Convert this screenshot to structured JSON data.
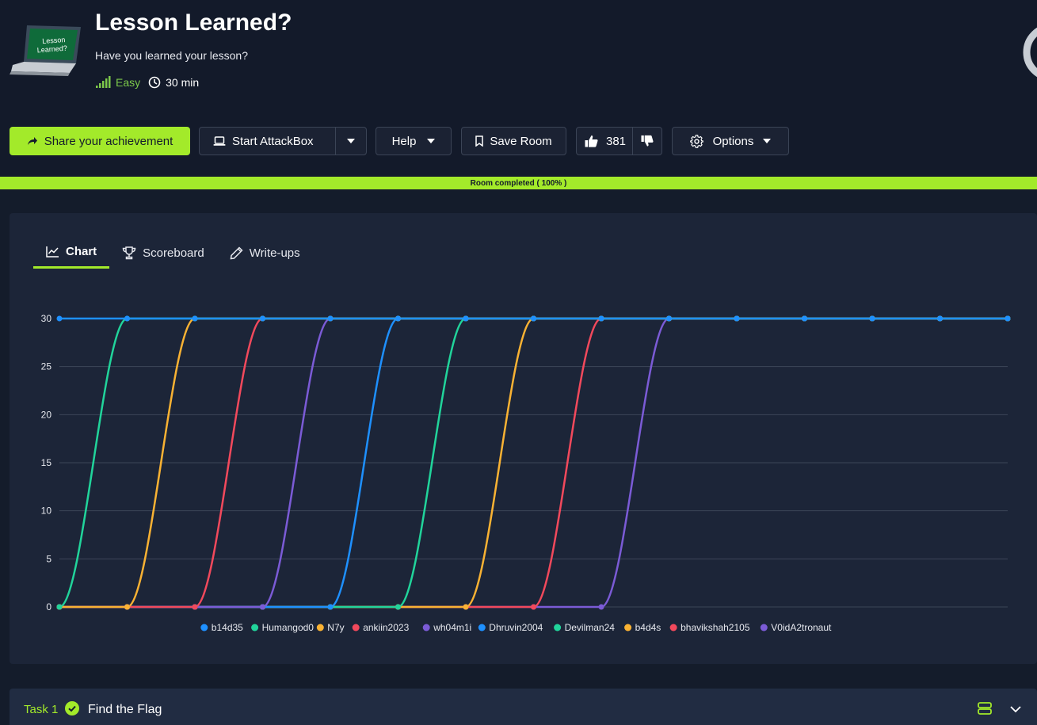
{
  "room": {
    "title": "Lesson Learned?",
    "subtitle": "Have you learned your lesson?",
    "difficulty": "Easy",
    "duration": "30 min",
    "laptop_screen_text": [
      "Lesson",
      "Learned?"
    ]
  },
  "toolbar": {
    "share_label": "Share your achievement",
    "attackbox_label": "Start AttackBox",
    "help_label": "Help",
    "save_label": "Save Room",
    "likes": "381",
    "options_label": "Options"
  },
  "progress": {
    "label": "Room completed ( 100% )",
    "percent": 100
  },
  "tabs": [
    {
      "label": "Chart",
      "icon": "chart-line-icon",
      "active": true
    },
    {
      "label": "Scoreboard",
      "icon": "trophy-icon",
      "active": false
    },
    {
      "label": "Write-ups",
      "icon": "pencil-icon",
      "active": false
    }
  ],
  "chart_data": {
    "type": "line",
    "ylim": [
      0,
      30
    ],
    "yticks": [
      0,
      5,
      10,
      15,
      20,
      25,
      30
    ],
    "x": [
      0,
      1,
      2,
      3,
      4,
      5,
      6,
      7,
      8,
      9,
      10,
      11,
      12,
      13,
      14
    ],
    "series": [
      {
        "name": "b14d35",
        "color": "#1e90ff",
        "values": [
          30,
          30,
          30,
          30,
          30,
          30,
          30,
          30,
          30,
          30,
          30,
          30,
          30,
          30,
          30
        ]
      },
      {
        "name": "Humangod0",
        "color": "#21d49b",
        "values": [
          0,
          30,
          30,
          30,
          30,
          30,
          30,
          30,
          30,
          30,
          30,
          30,
          30,
          30,
          30
        ]
      },
      {
        "name": "N7y",
        "color": "#f9b233",
        "values": [
          0,
          0,
          30,
          30,
          30,
          30,
          30,
          30,
          30,
          30,
          30,
          30,
          30,
          30,
          30
        ]
      },
      {
        "name": "ankiin2023",
        "color": "#f2495c",
        "values": [
          0,
          0,
          0,
          30,
          30,
          30,
          30,
          30,
          30,
          30,
          30,
          30,
          30,
          30,
          30
        ]
      },
      {
        "name": "wh04m1i",
        "color": "#7b5bd6",
        "values": [
          0,
          0,
          0,
          0,
          30,
          30,
          30,
          30,
          30,
          30,
          30,
          30,
          30,
          30,
          30
        ]
      },
      {
        "name": "Dhruvin2004",
        "color": "#1e90ff",
        "values": [
          0,
          0,
          0,
          0,
          0,
          30,
          30,
          30,
          30,
          30,
          30,
          30,
          30,
          30,
          30
        ]
      },
      {
        "name": "Devilman24",
        "color": "#21d49b",
        "values": [
          0,
          0,
          0,
          0,
          0,
          0,
          30,
          30,
          30,
          30,
          30,
          30,
          30,
          30,
          30
        ]
      },
      {
        "name": "b4d4s",
        "color": "#f9b233",
        "values": [
          0,
          0,
          0,
          0,
          0,
          0,
          0,
          30,
          30,
          30,
          30,
          30,
          30,
          30,
          30
        ]
      },
      {
        "name": "bhavikshah2105",
        "color": "#f2495c",
        "values": [
          0,
          0,
          0,
          0,
          0,
          0,
          0,
          0,
          30,
          30,
          30,
          30,
          30,
          30,
          30
        ]
      },
      {
        "name": "V0idA2tronaut",
        "color": "#7b5bd6",
        "values": [
          0,
          0,
          0,
          0,
          0,
          0,
          0,
          0,
          0,
          30,
          30,
          30,
          30,
          30,
          30
        ]
      }
    ],
    "grid": true,
    "legend": "bottom"
  },
  "task": {
    "label": "Task 1",
    "title": "Find the Flag"
  }
}
